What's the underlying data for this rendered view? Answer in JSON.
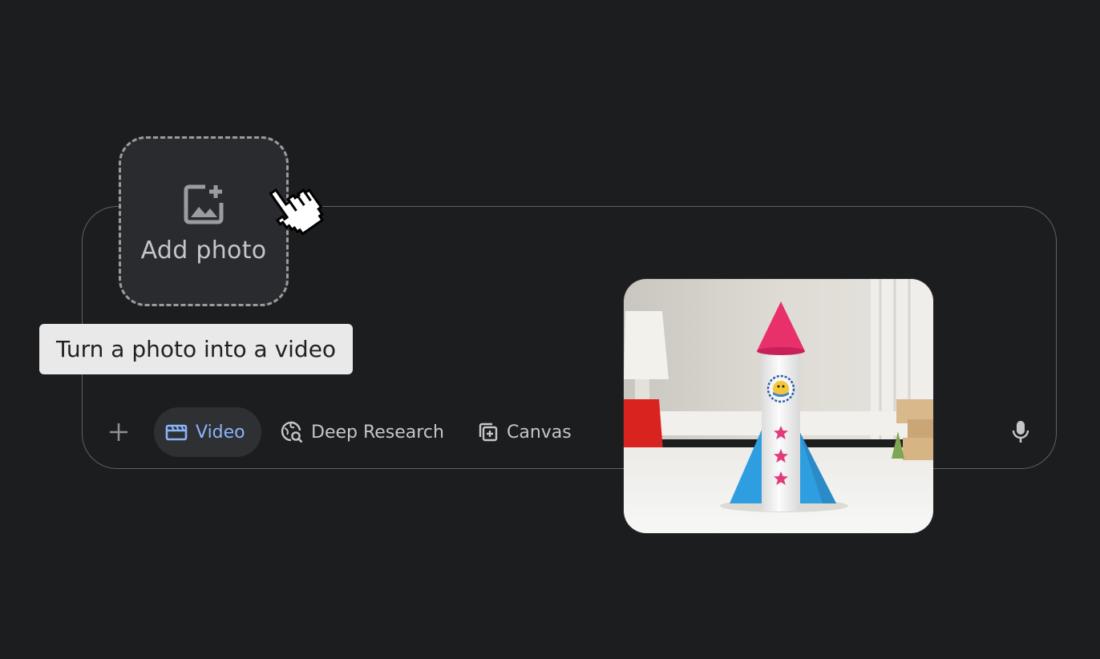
{
  "add_photo": {
    "label": "Add photo",
    "icon": "add-photo-icon"
  },
  "tooltip": {
    "text": "Turn a photo into a video"
  },
  "toolbar": {
    "plus_icon": "plus-icon",
    "video_label": "Video",
    "video_icon": "clapperboard-icon",
    "deep_research_label": "Deep Research",
    "deep_research_icon": "globe-search-icon",
    "canvas_label": "Canvas",
    "canvas_icon": "canvas-add-icon",
    "mic_icon": "microphone-icon"
  },
  "photo": {
    "subject": "rocket-photo",
    "rocket_colors": {
      "nose": "#e8306a",
      "fins": "#2f9ee0",
      "body": "#f3f3f3"
    }
  },
  "colors": {
    "background": "#1c1d1f",
    "accent": "#8ab4f8",
    "tooltip_bg": "#e9e9ea",
    "text_muted": "#c4c6ca"
  }
}
